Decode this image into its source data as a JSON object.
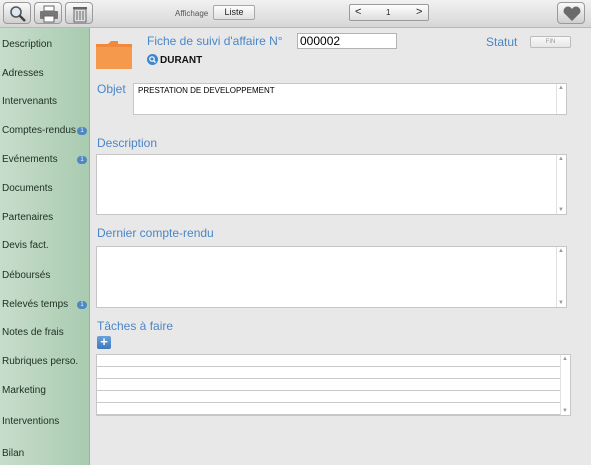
{
  "toolbar": {
    "search_icon": "magnifier-icon",
    "print_icon": "printer-icon",
    "delete_icon": "trash-icon",
    "affichage_label": "Affichage",
    "liste_button": "Liste",
    "pager": {
      "prev": "<",
      "current": "1",
      "next": ">"
    },
    "favorite_icon": "heart-icon"
  },
  "sidebar": {
    "items": [
      {
        "label": "Description"
      },
      {
        "label": "Adresses"
      },
      {
        "label": "Intervenants"
      },
      {
        "label": "Comptes-rendus",
        "badge": "1"
      },
      {
        "label": "Evénements",
        "badge": "1"
      },
      {
        "label": "Documents"
      },
      {
        "label": "Partenaires"
      },
      {
        "label": "Devis fact."
      },
      {
        "label": "Déboursés"
      },
      {
        "label": "Relevés temps",
        "badge": "1"
      },
      {
        "label": "Notes de frais"
      },
      {
        "label": "Rubriques perso."
      },
      {
        "label": "Marketing"
      },
      {
        "label": "Interventions"
      },
      {
        "label": "Bilan"
      }
    ]
  },
  "header": {
    "title": "Fiche de suivi d'affaire N°",
    "number": "000002",
    "statut_label": "Statut",
    "statut_button": "FIN",
    "user_name": "DURANT",
    "folder_color": "#f08a3a"
  },
  "fields": {
    "objet_label": "Objet",
    "objet_value": "PRESTATION DE DEVELOPPEMENT",
    "description_label": "Description",
    "description_value": "",
    "dernier_cr_label": "Dernier compte-rendu",
    "dernier_cr_value": "",
    "taches_label": "Tâches à faire",
    "add_task": "+"
  },
  "colors": {
    "accent": "#4a86c8",
    "sidebar": "#b8d4bd"
  }
}
